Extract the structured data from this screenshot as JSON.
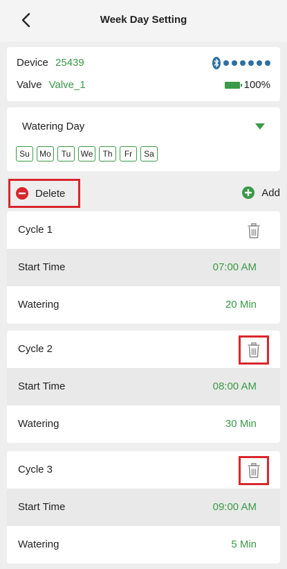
{
  "header": {
    "title": "Week Day Setting",
    "back_icon": "chevron-left-icon"
  },
  "device": {
    "device_label": "Device",
    "device_value": "25439",
    "valve_label": "Valve",
    "valve_value": "Valve_1",
    "battery_text": "100%",
    "signal_icon": "bluetooth-icon"
  },
  "watering_day": {
    "title": "Watering Day",
    "days": [
      "Su",
      "Mo",
      "Tu",
      "We",
      "Th",
      "Fr",
      "Sa"
    ]
  },
  "actions": {
    "delete_label": "Delete",
    "add_label": "Add"
  },
  "cycles": [
    {
      "name": "Cycle 1",
      "start_label": "Start Time",
      "start_value": "07:00 AM",
      "watering_label": "Watering",
      "watering_value": "20 Min"
    },
    {
      "name": "Cycle 2",
      "start_label": "Start Time",
      "start_value": "08:00 AM",
      "watering_label": "Watering",
      "watering_value": "30 Min"
    },
    {
      "name": "Cycle 3",
      "start_label": "Start Time",
      "start_value": "09:00 AM",
      "watering_label": "Watering",
      "watering_value": "5 Min"
    }
  ],
  "colors": {
    "accent": "#3a9a47",
    "highlight": "#d9262c",
    "signal": "#2c6fa3"
  }
}
